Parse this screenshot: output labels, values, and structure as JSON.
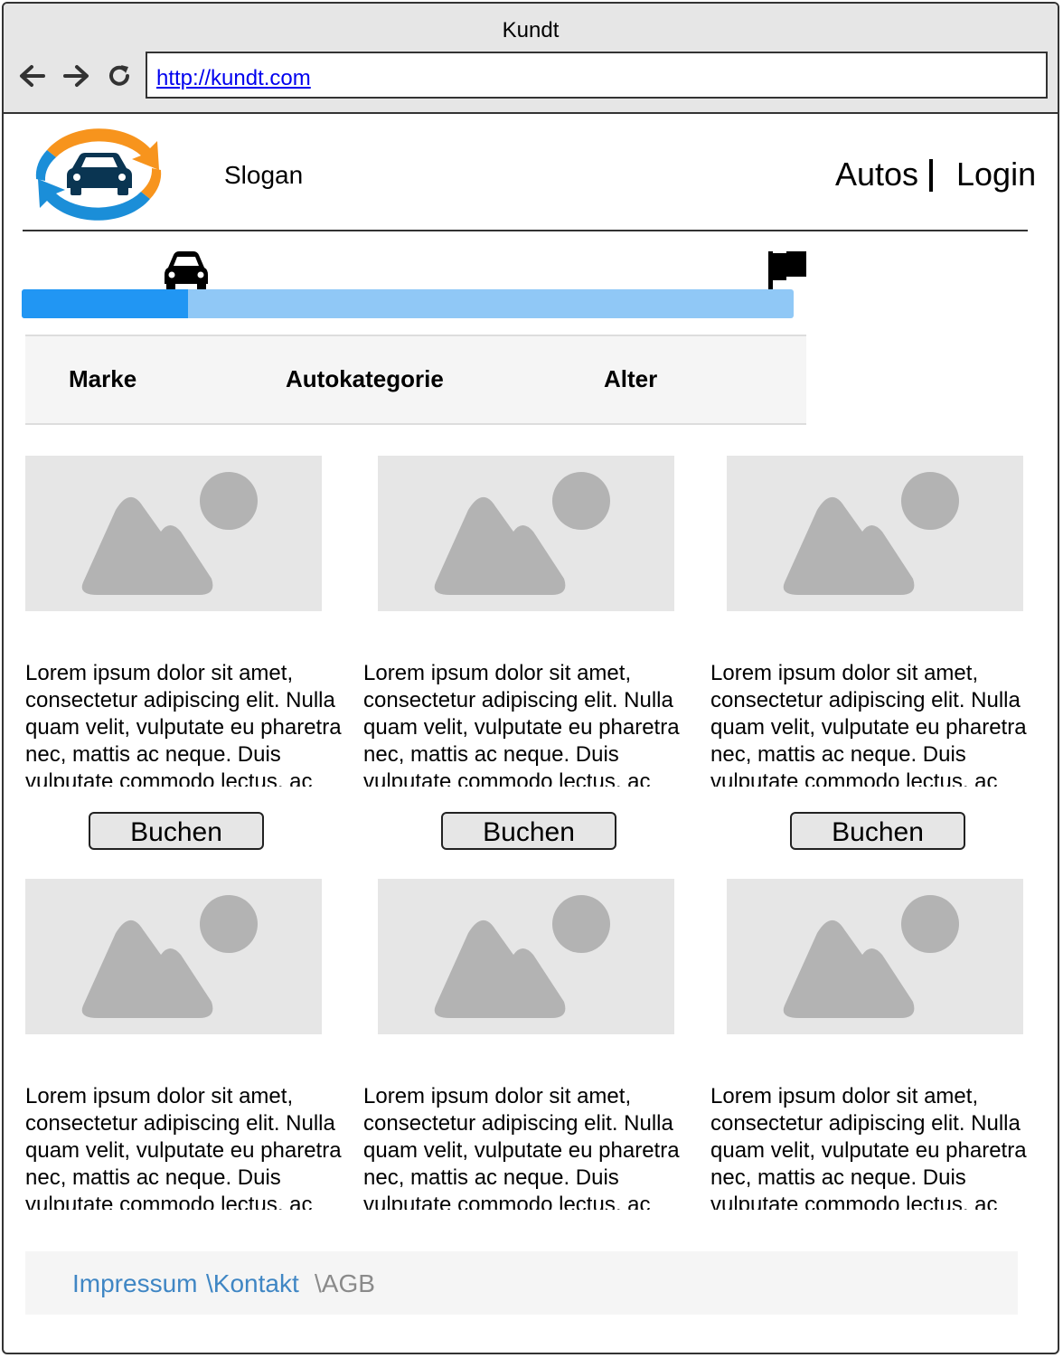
{
  "browser": {
    "title": "Kundt",
    "url": "http://kundt.com"
  },
  "header": {
    "slogan": "Slogan",
    "nav": [
      "Autos",
      "Login"
    ]
  },
  "progress": {
    "value": 0.215,
    "start_icon": "car-icon",
    "end_icon": "flag-icon"
  },
  "filters": [
    "Marke",
    "Autokategorie",
    "Alter"
  ],
  "cards": [
    {
      "text": "Lorem ipsum dolor sit amet, consectetur adipiscing elit. Nulla quam velit, vulputate eu pharetra nec, mattis ac neque. Duis vulputate commodo lectus, ac",
      "button": "Buchen"
    },
    {
      "text": "Lorem ipsum dolor sit amet, consectetur adipiscing elit. Nulla quam velit, vulputate eu pharetra nec, mattis ac neque. Duis vulputate commodo lectus, ac",
      "button": "Buchen"
    },
    {
      "text": "Lorem ipsum dolor sit amet, consectetur adipiscing elit. Nulla quam velit, vulputate eu pharetra nec, mattis ac neque. Duis vulputate commodo lectus, ac",
      "button": "Buchen"
    },
    {
      "text": "Lorem ipsum dolor sit amet, consectetur adipiscing elit. Nulla quam velit, vulputate eu pharetra nec, mattis ac neque. Duis vulputate commodo lectus, ac"
    },
    {
      "text": "Lorem ipsum dolor sit amet, consectetur adipiscing elit. Nulla quam velit, vulputate eu pharetra nec, mattis ac neque. Duis vulputate commodo lectus, ac"
    },
    {
      "text": "Lorem ipsum dolor sit amet, consectetur adipiscing elit. Nulla quam velit, vulputate eu pharetra nec, mattis ac neque. Duis vulputate commodo lectus, ac"
    }
  ],
  "footer": {
    "impressum": "Impressum",
    "kontakt": "\\Kontakt",
    "agb": "\\AGB"
  },
  "colors": {
    "progress_fill": "#2196f3",
    "progress_track": "#90c8f6",
    "link": "#3f86c4",
    "logo_orange": "#f7941d",
    "logo_blue": "#1b8ed8"
  }
}
